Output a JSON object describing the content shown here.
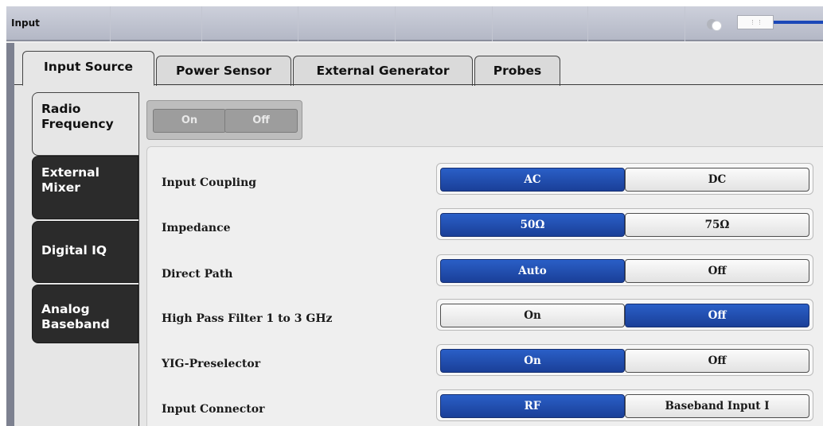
{
  "window": {
    "title": "Input"
  },
  "top_tabs": [
    {
      "label": "Input Source",
      "active": true
    },
    {
      "label": "Power Sensor",
      "active": false
    },
    {
      "label": "External Generator",
      "active": false
    },
    {
      "label": "Probes",
      "active": false
    }
  ],
  "side_tabs": [
    {
      "label_line1": "Radio",
      "label_line2": "Frequency",
      "active": true
    },
    {
      "label_line1": "External",
      "label_line2": "Mixer",
      "active": false
    },
    {
      "label_line1": "Digital IQ",
      "label_line2": "",
      "active": false
    },
    {
      "label_line1": "Analog",
      "label_line2": "Baseband",
      "active": false
    }
  ],
  "rf_state": {
    "on_label": "On",
    "off_label": "Off",
    "enabled": false
  },
  "settings": [
    {
      "label": "Input Coupling",
      "options": [
        "AC",
        "DC"
      ],
      "selected": 0
    },
    {
      "label": "Impedance",
      "options": [
        "50Ω",
        "75Ω"
      ],
      "selected": 0
    },
    {
      "label": "Direct Path",
      "options": [
        "Auto",
        "Off"
      ],
      "selected": 0
    },
    {
      "label": "High Pass Filter 1 to 3 GHz",
      "options": [
        "On",
        "Off"
      ],
      "selected": 1
    },
    {
      "label": "YIG-Preselector",
      "options": [
        "On",
        "Off"
      ],
      "selected": 0
    },
    {
      "label": "Input Connector",
      "options": [
        "RF",
        "Baseband Input I"
      ],
      "selected": 0
    }
  ],
  "colors": {
    "selected": "#1e4aa8",
    "accent_track": "#1b48b8"
  },
  "icons": [
    "dialog-toggle-icon",
    "scroll-handle"
  ]
}
